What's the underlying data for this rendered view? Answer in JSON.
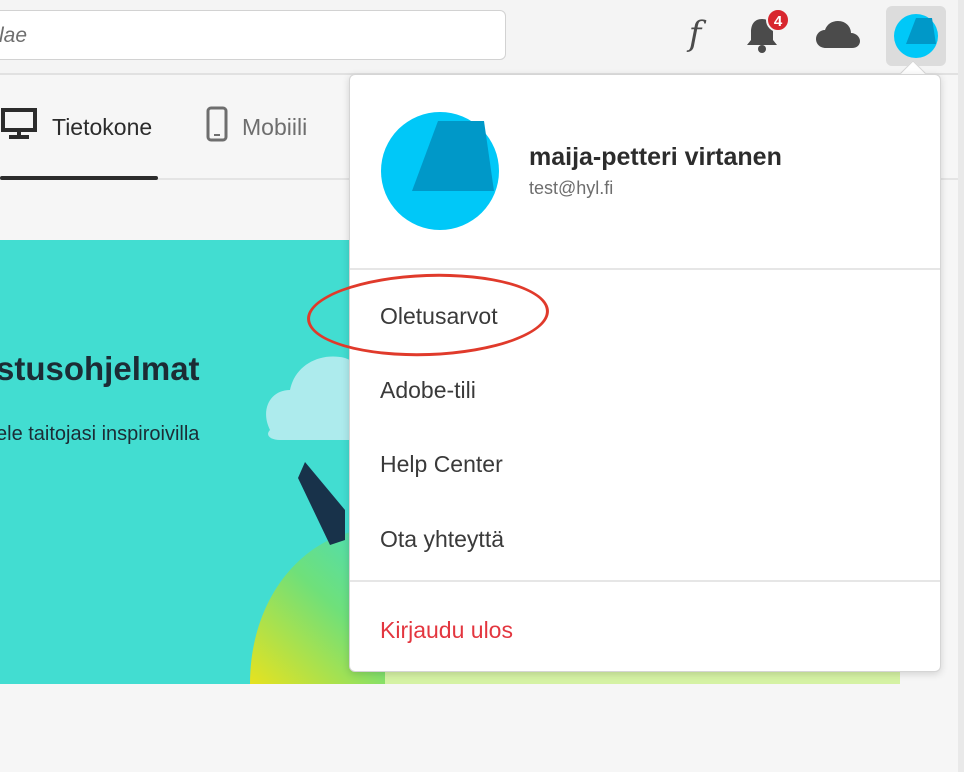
{
  "search": {
    "placeholder": "lae"
  },
  "header": {
    "notifications_count": "4",
    "icons": [
      "fonts-icon",
      "bell-icon",
      "cloud-icon",
      "avatar"
    ]
  },
  "tabs": [
    {
      "label": "Tietokone",
      "icon": "desktop-icon",
      "selected": true
    },
    {
      "label": "Mobiili",
      "icon": "mobile-icon",
      "selected": false
    }
  ],
  "banner": {
    "heading": "stusohjelmat",
    "subtitle": "ele taitojasi inspiroivilla"
  },
  "profile": {
    "name": "maija-petteri virtanen",
    "email": "test@hyl.fi"
  },
  "menu": {
    "items": [
      "Oletusarvot",
      "Adobe-tili",
      "Help Center",
      "Ota yhteyttä"
    ],
    "signout": "Kirjaudu ulos"
  },
  "colors": {
    "banner_bg": "#42ddd1",
    "avatar_light": "#00c8f8",
    "avatar_dark": "#0098c8",
    "signout": "#e3363f",
    "badge": "#d8262e",
    "annotation": "#e03a2b"
  }
}
